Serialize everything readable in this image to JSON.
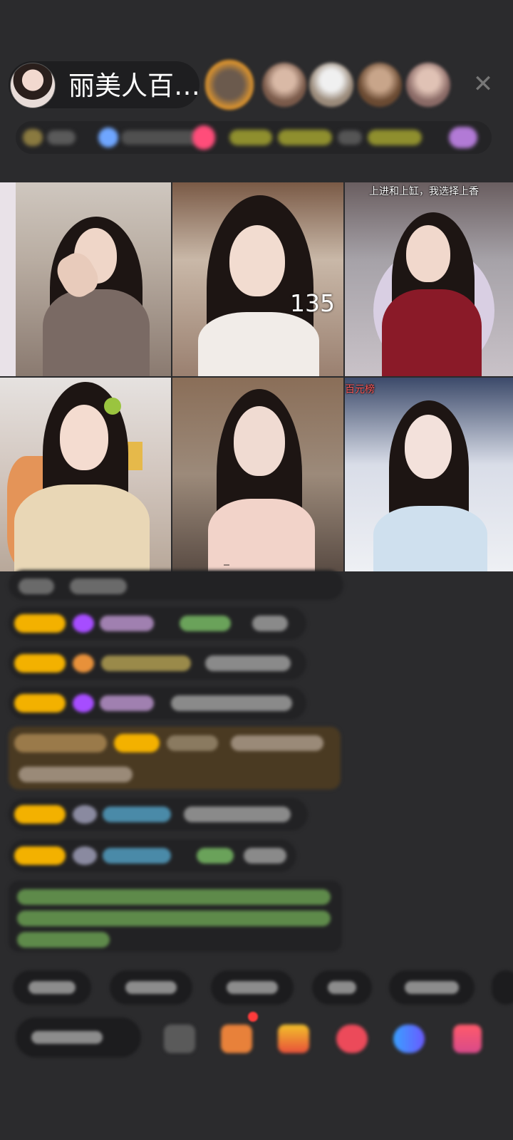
{
  "header": {
    "host_name": "丽美人百…",
    "close_icon": "close-icon"
  },
  "grid": {
    "cells": [
      {
        "caption": "",
        "number": ""
      },
      {
        "caption": "",
        "number": "135"
      },
      {
        "caption": "上进和上缸，我选择上香",
        "number": ""
      },
      {
        "caption": "",
        "number": ""
      },
      {
        "caption": "",
        "number": ""
      },
      {
        "caption": "百元榜",
        "number": ""
      }
    ]
  },
  "colors": {
    "background": "#2b2b2d",
    "badge_gold": "#f3b100",
    "accent_purple": "#a64dff",
    "accent_green": "#7cc36b"
  }
}
